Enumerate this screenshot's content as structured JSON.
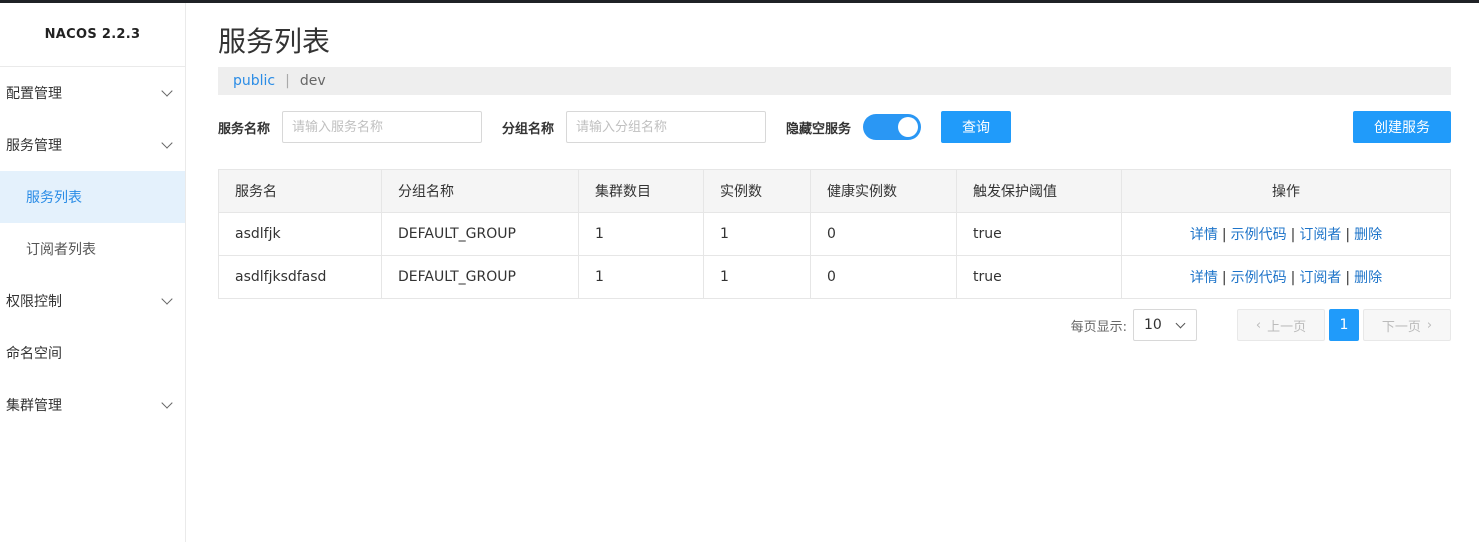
{
  "app": {
    "brand": "NACOS 2.2.3"
  },
  "sidebar": {
    "items": [
      {
        "label": "配置管理"
      },
      {
        "label": "服务管理"
      },
      {
        "label": "服务列表"
      },
      {
        "label": "订阅者列表"
      },
      {
        "label": "权限控制"
      },
      {
        "label": "命名空间"
      },
      {
        "label": "集群管理"
      }
    ]
  },
  "page": {
    "title": "服务列表"
  },
  "breadcrumb": {
    "namespace_link": "public",
    "separator": "|",
    "namespace_current": "dev"
  },
  "filters": {
    "service_name_label": "服务名称",
    "service_name_placeholder": "请输入服务名称",
    "group_name_label": "分组名称",
    "group_name_placeholder": "请输入分组名称",
    "hide_empty_label": "隐藏空服务",
    "query_button": "查询",
    "create_button": "创建服务"
  },
  "table": {
    "columns": [
      "服务名",
      "分组名称",
      "集群数目",
      "实例数",
      "健康实例数",
      "触发保护阈值",
      "操作"
    ],
    "rows": [
      {
        "name": "asdlfjk",
        "group": "DEFAULT_GROUP",
        "clusters": "1",
        "instances": "1",
        "healthy": "0",
        "threshold": "true"
      },
      {
        "name": "asdlfjksdfasd",
        "group": "DEFAULT_GROUP",
        "clusters": "1",
        "instances": "1",
        "healthy": "0",
        "threshold": "true"
      }
    ],
    "actions": {
      "detail": "详情",
      "sample_code": "示例代码",
      "subscribers": "订阅者",
      "delete": "删除",
      "separator": "|"
    }
  },
  "pagination": {
    "per_page_label": "每页显示:",
    "per_page_value": "10",
    "prev_label": "上一页",
    "current_page": "1",
    "next_label": "下一页"
  },
  "colors": {
    "accent": "#209bfa",
    "link": "#1e74c9",
    "active_nav_bg": "#e4f1fc"
  }
}
